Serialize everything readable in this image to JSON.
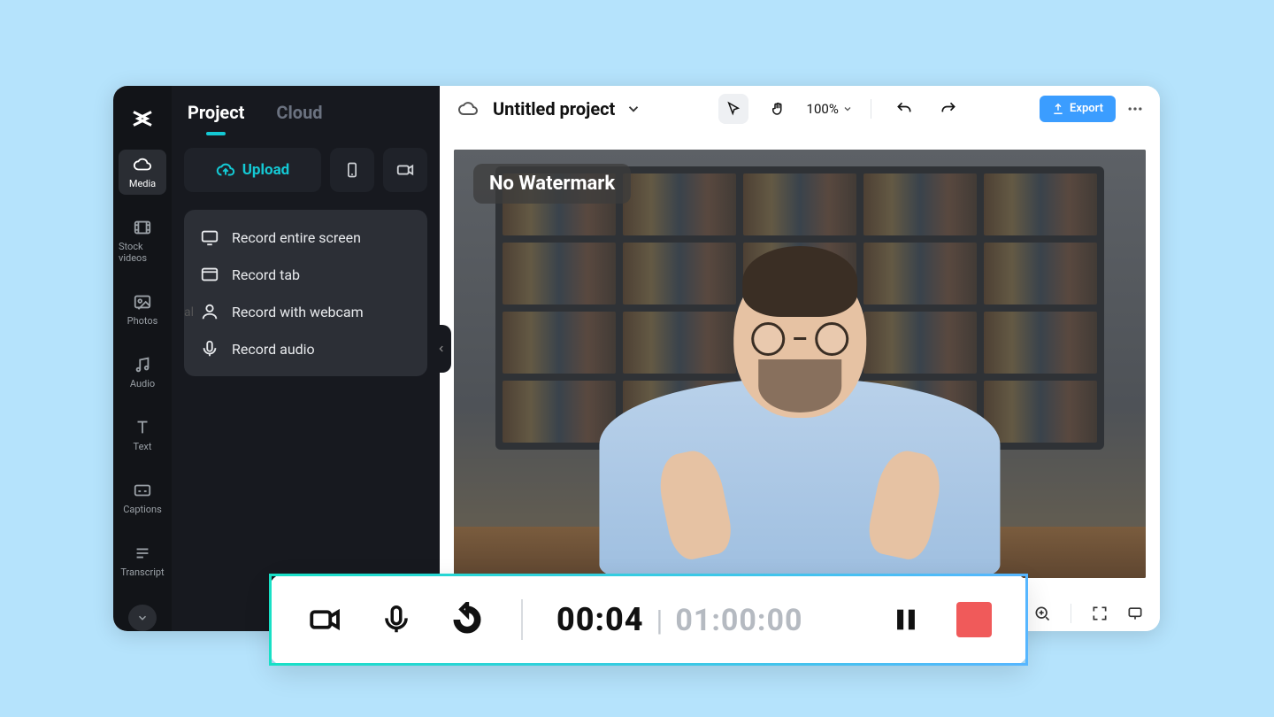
{
  "sidebar": {
    "tabs": {
      "project": "Project",
      "cloud": "Cloud"
    },
    "upload_label": "Upload",
    "record_menu": [
      "Record entire screen",
      "Record tab",
      "Record with webcam",
      "Record audio"
    ],
    "hint_text": "al"
  },
  "rail": {
    "items": [
      {
        "label": "Media"
      },
      {
        "label": "Stock videos"
      },
      {
        "label": "Photos"
      },
      {
        "label": "Audio"
      },
      {
        "label": "Text"
      },
      {
        "label": "Captions"
      },
      {
        "label": "Transcript"
      }
    ]
  },
  "topbar": {
    "project_title": "Untitled project",
    "zoom": "100%",
    "export_label": "Export"
  },
  "preview": {
    "watermark_badge": "No Watermark"
  },
  "recorder": {
    "elapsed": "00:04",
    "separator": "|",
    "total": "01:00:00"
  }
}
